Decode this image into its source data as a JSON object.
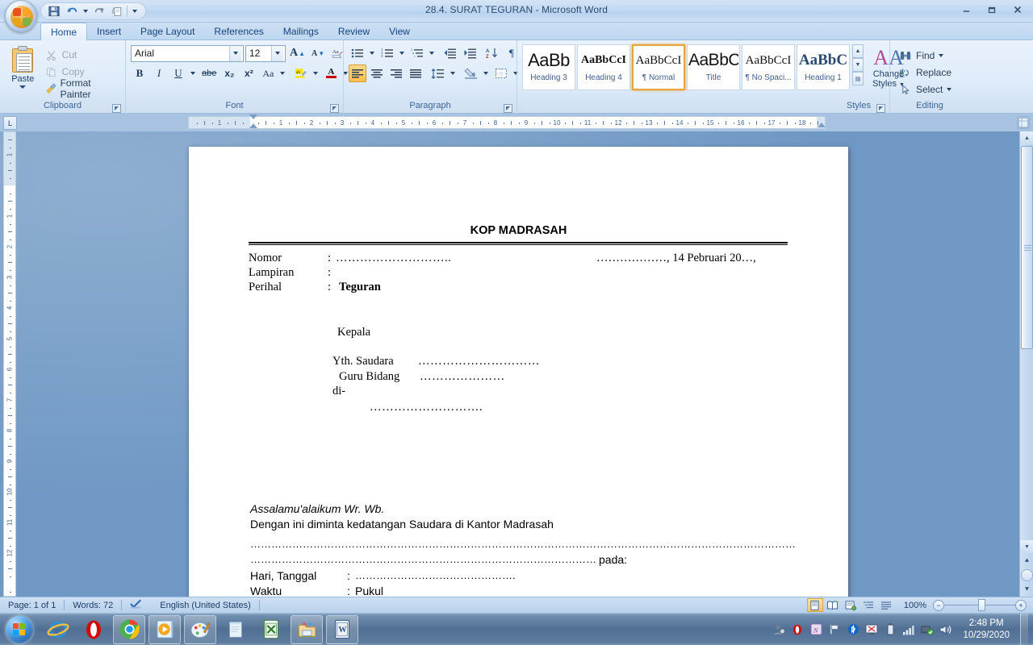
{
  "window": {
    "title": "28.4. SURAT TEGURAN - Microsoft Word",
    "minimize": "—",
    "maximize": "❐",
    "close": "✕"
  },
  "quick_access": {
    "save": "save-icon",
    "undo": "undo-icon",
    "redo": "redo-icon",
    "print_preview": "print-preview-icon",
    "customize": "customize-icon"
  },
  "tabs": [
    {
      "label": "Home",
      "active": true
    },
    {
      "label": "Insert",
      "active": false
    },
    {
      "label": "Page Layout",
      "active": false
    },
    {
      "label": "References",
      "active": false
    },
    {
      "label": "Mailings",
      "active": false
    },
    {
      "label": "Review",
      "active": false
    },
    {
      "label": "View",
      "active": false
    }
  ],
  "ribbon": {
    "clipboard": {
      "label": "Clipboard",
      "paste": "Paste",
      "cut": "Cut",
      "copy": "Copy",
      "format_painter": "Format Painter"
    },
    "font": {
      "label": "Font",
      "font_name": "Arial",
      "font_size": "12",
      "grow": "A",
      "shrink": "A",
      "clear_formatting": "Aa",
      "bold": "B",
      "italic": "I",
      "underline": "U",
      "strikethrough": "abe",
      "subscript": "x₂",
      "superscript": "x²",
      "change_case": "Aa",
      "highlight": "ab",
      "font_color": "A"
    },
    "paragraph": {
      "label": "Paragraph"
    },
    "styles": {
      "label": "Styles",
      "gallery": [
        {
          "preview": "AaBb",
          "name": "Heading 3",
          "selected": false
        },
        {
          "preview": "AaBbCcI",
          "name": "Heading 4",
          "selected": false
        },
        {
          "preview": "AaBbCcI",
          "name": "¶ Normal",
          "selected": true
        },
        {
          "preview": "AaBbC",
          "name": "Title",
          "selected": false
        },
        {
          "preview": "AaBbCcI",
          "name": "¶ No Spaci...",
          "selected": false
        },
        {
          "preview": "AaBbC",
          "name": "Heading 1",
          "selected": false
        }
      ],
      "change_styles": "Change\nStyles"
    },
    "editing": {
      "label": "Editing",
      "find": "Find",
      "replace": "Replace",
      "select": "Select"
    }
  },
  "ruler": {
    "tab_selector": "L",
    "h_numbers": [
      "2",
      "1",
      "1",
      "2",
      "3",
      "4",
      "5",
      "6",
      "7",
      "8",
      "9",
      "10",
      "11",
      "12",
      "13",
      "14",
      "15",
      "16",
      "17",
      "18",
      "19"
    ],
    "v_numbers": [
      "2",
      "1",
      "1",
      "2",
      "3",
      "4",
      "5",
      "6",
      "7",
      "8",
      "9",
      "10",
      "11",
      "12"
    ]
  },
  "document": {
    "header_title": "KOP MADRASAH",
    "fields": [
      {
        "label": "Nomor",
        "colon": ":",
        "value": "……………………….."
      },
      {
        "label": "Lampiran",
        "colon": ":",
        "value": ""
      },
      {
        "label": "Perihal",
        "colon": ":",
        "value": "Teguran"
      }
    ],
    "date_line": "………………, 14 Pebruari 20…,",
    "kepada": "Kepala",
    "addressee_1": "Yth. Saudara",
    "addressee_1_dots": "…………………………",
    "addressee_2": "Guru Bidang",
    "addressee_2_dots": "…………………",
    "addressee_3": "di-",
    "addressee_4_dots": "……………………….",
    "salutation": "Assalamu'alaikum Wr. Wb.",
    "body_line": "Dengan ini diminta kedatangan Saudara di Kantor Madrasah",
    "dots_full": "…………………………………………………………………………………………………………………………………………",
    "dots_partial": "………………………………………………………………………………………",
    "pada": "pada:",
    "schedule": [
      {
        "label": "Hari, Tanggal",
        "colon": ":",
        "value": "………………………………………."
      },
      {
        "label": "Waktu",
        "colon": ":",
        "value": "Pukul"
      }
    ]
  },
  "status_bar": {
    "page": "Page: 1 of 1",
    "words": "Words: 72",
    "proofing": "proofing-icon",
    "language": "English (United States)",
    "views": [
      "print-layout-view",
      "full-screen-reading-view",
      "web-layout-view",
      "outline-view",
      "draft-view"
    ],
    "zoom": "100%",
    "zoom_out": "−",
    "zoom_in": "+"
  },
  "taskbar": {
    "start": "windows-start-orb",
    "items": [
      {
        "name": "internet-explorer-icon"
      },
      {
        "name": "opera-icon"
      },
      {
        "name": "google-chrome-icon"
      },
      {
        "name": "media-player-icon"
      },
      {
        "name": "paint-icon"
      },
      {
        "name": "notepad-icon"
      },
      {
        "name": "excel-icon"
      },
      {
        "name": "file-explorer-icon"
      },
      {
        "name": "word-icon"
      }
    ],
    "tray": [
      "user-account-icon",
      "opera-tray-icon",
      "onenote-tray-icon",
      "flag-icon",
      "bluetooth-icon",
      "display-icon",
      "battery-icon",
      "network-signal-icon",
      "network-status-icon",
      "volume-icon"
    ],
    "time": "2:48 PM",
    "date": "10/29/2020"
  }
}
